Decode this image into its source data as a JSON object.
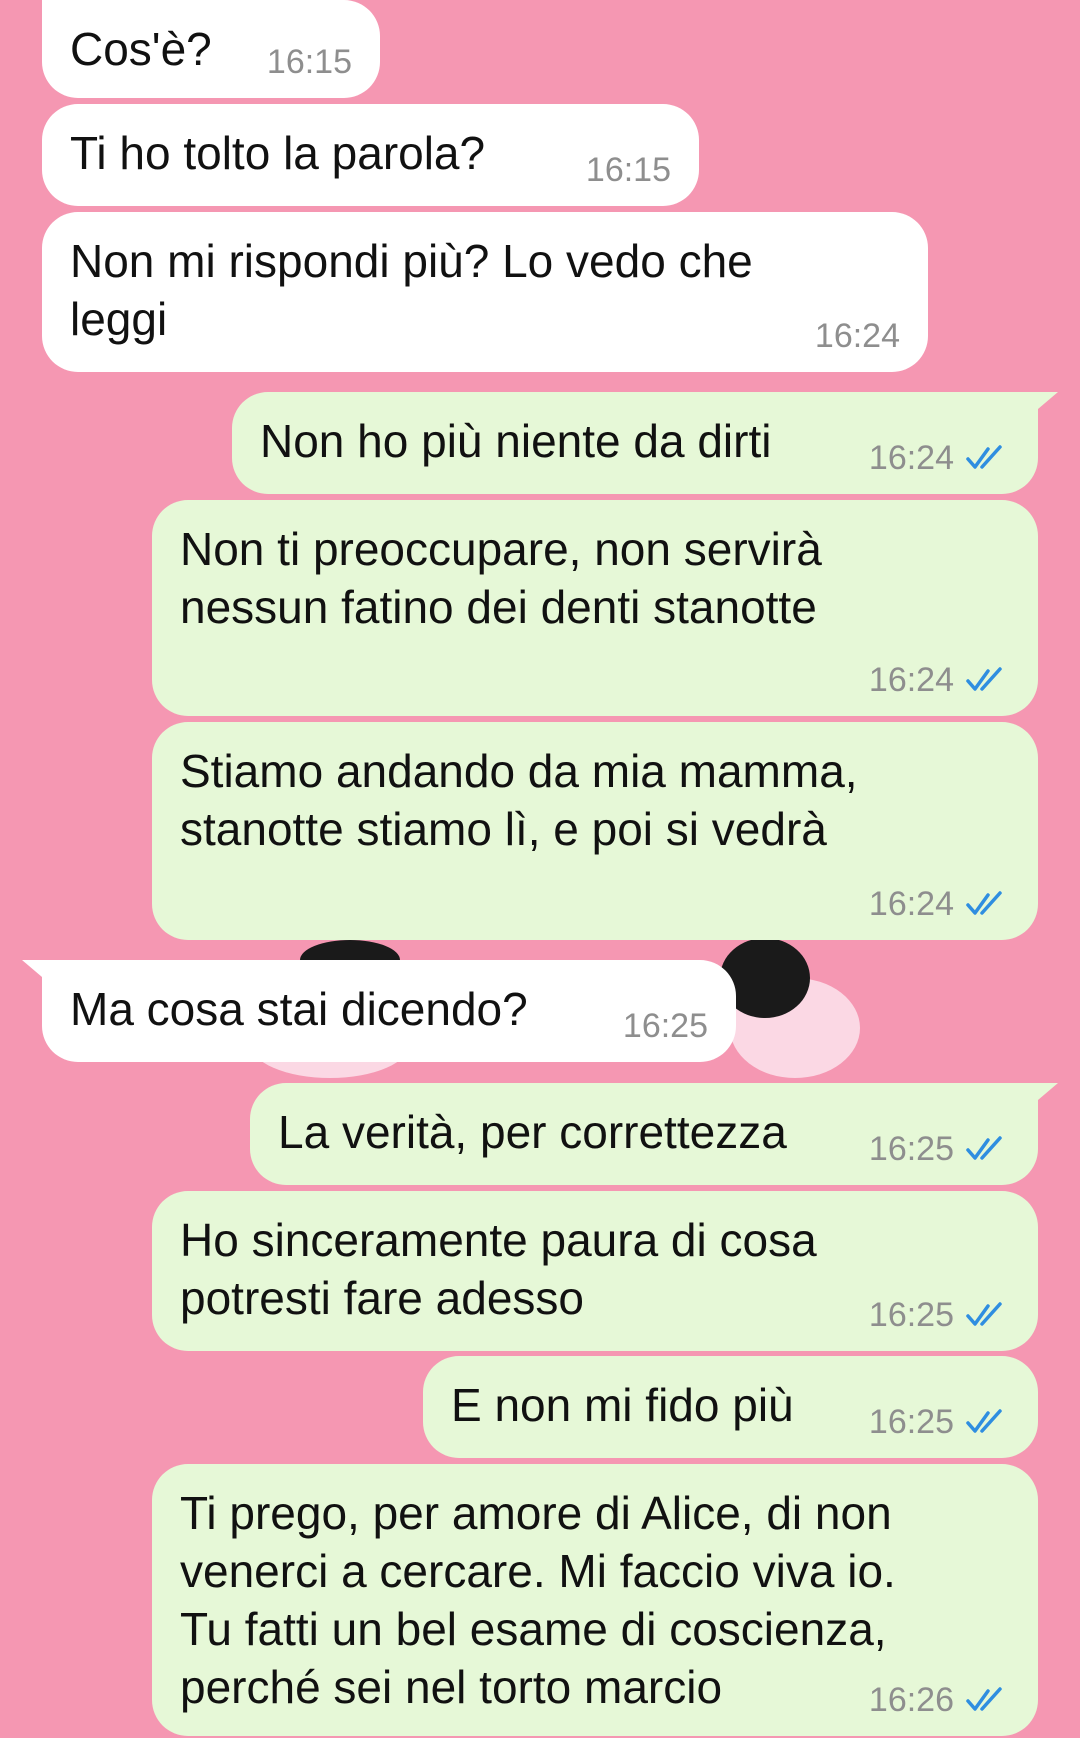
{
  "colors": {
    "background": "#f597b2",
    "incoming_bubble": "#ffffff",
    "outgoing_bubble": "#e6f8d7",
    "timestamp": "#8e8e8e",
    "read_ticks": "#2f8ee0"
  },
  "messages": [
    {
      "direction": "in",
      "text": "Cos'è?",
      "time": "16:15"
    },
    {
      "direction": "in",
      "text": "Ti ho tolto la parola?",
      "time": "16:15"
    },
    {
      "direction": "in",
      "text": "Non mi rispondi più? Lo vedo che leggi",
      "time": "16:24"
    },
    {
      "direction": "out",
      "text": "Non ho più niente da dirti",
      "time": "16:24",
      "status_icon": "double-check-icon"
    },
    {
      "direction": "out",
      "text": "Non ti preoccupare, non servirà nessun fatino dei denti stanotte",
      "time": "16:24",
      "status_icon": "double-check-icon"
    },
    {
      "direction": "out",
      "text": "Stiamo andando da mia mamma, stanotte stiamo lì, e poi si vedrà",
      "time": "16:24",
      "status_icon": "double-check-icon"
    },
    {
      "direction": "in",
      "text": "Ma cosa stai dicendo?",
      "time": "16:25"
    },
    {
      "direction": "out",
      "text": "La verità, per correttezza",
      "time": "16:25",
      "status_icon": "double-check-icon"
    },
    {
      "direction": "out",
      "text": "Ho sinceramente paura di cosa potresti fare adesso",
      "time": "16:25",
      "status_icon": "double-check-icon"
    },
    {
      "direction": "out",
      "text": "E non mi fido più",
      "time": "16:25",
      "status_icon": "double-check-icon"
    },
    {
      "direction": "out",
      "text": "Ti prego, per amore di Alice, di non venerci a cercare. Mi faccio viva io. Tu fatti un bel esame di coscienza, perché sei nel torto marcio",
      "time": "16:26",
      "status_icon": "double-check-icon"
    }
  ]
}
